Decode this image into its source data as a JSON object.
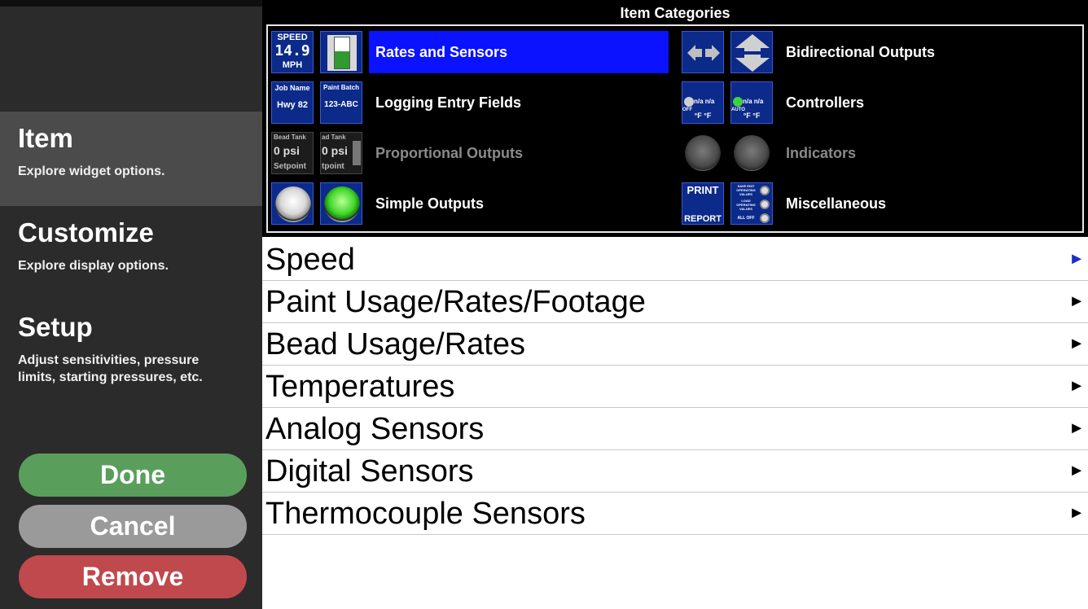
{
  "sidebar": {
    "sections": [
      {
        "title": "Item",
        "description": "Explore widget options."
      },
      {
        "title": "Customize",
        "description": "Explore display options."
      },
      {
        "title": "Setup",
        "description": "Adjust sensitivities, pressure limits, starting pressures, etc."
      }
    ],
    "buttons": {
      "done": "Done",
      "cancel": "Cancel",
      "remove": "Remove"
    }
  },
  "categories": {
    "title": "Item Categories",
    "items": [
      {
        "label": "Rates and Sensors",
        "selected": true
      },
      {
        "label": "Bidirectional Outputs"
      },
      {
        "label": "Logging Entry Fields"
      },
      {
        "label": "Controllers"
      },
      {
        "label": "Proportional Outputs",
        "disabled": true
      },
      {
        "label": "Indicators",
        "disabled": true
      },
      {
        "label": "Simple Outputs"
      },
      {
        "label": "Miscellaneous"
      }
    ],
    "icon_text": {
      "speed_caption": "SPEED",
      "speed_value": "14.9",
      "speed_unit": "MPH",
      "job_name_caption": "Job Name",
      "job_name_value": "Hwy 82",
      "paint_batch_caption": "Paint Batch",
      "paint_batch_value": "123-ABC",
      "bead_tank_caption": "Bead Tank",
      "bead_tank_caption_cut": "ad Tank",
      "bead_tank_value": "0 psi",
      "setpoint_caption": "Setpoint",
      "setpoint_caption_cut": "tpoint",
      "controller_value": "n/a n/a",
      "controller_units": "°F  °F",
      "controller_off": "OFF",
      "controller_auto": "AUTO",
      "print_label": "PRINT",
      "report_label": "REPORT",
      "misc_save_edit": "SAVE EDIT OPERATING VALUES",
      "misc_load": "LOAD OPERATING VALUES",
      "misc_all_off": "ALL OFF"
    }
  },
  "list": {
    "rows": [
      "Speed",
      "Paint Usage/Rates/Footage",
      "Bead Usage/Rates",
      "Temperatures",
      "Analog Sensors",
      "Digital Sensors",
      "Thermocouple Sensors"
    ],
    "arrow": "►"
  }
}
